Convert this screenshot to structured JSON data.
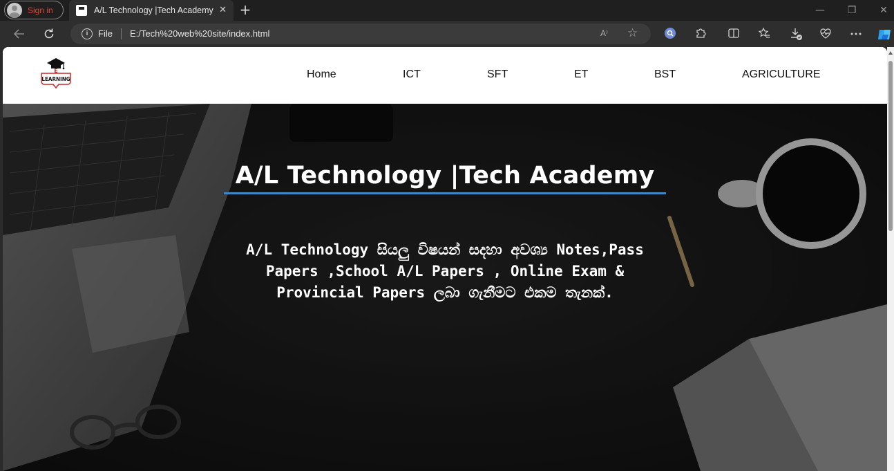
{
  "browser": {
    "profile_label": "Sign in",
    "tab_title": "A/L Technology |Tech Academy",
    "tab_close": "✕",
    "new_tab": "+",
    "address_scheme": "File",
    "address_url": "E:/Tech%20web%20site/index.html",
    "read_aloud": "A⁾",
    "window_controls": [
      "—",
      "❐",
      "✕"
    ]
  },
  "site": {
    "logo_text": "LEARNING",
    "logo_letter": "E",
    "nav": [
      "Home",
      "ICT",
      "SFT",
      "ET",
      "BST",
      "AGRICULTURE"
    ],
    "hero_title": "A/L Technology |Tech Academy",
    "hero_text": "A/L Technology සියලු විෂයන් සදහා අවශ්‍ය Notes,Pass Papers ,School A/L Papers , Online Exam & Provincial Papers ලබා ගැනීමට එකම තැනක්."
  },
  "colors": {
    "accent_rule": "#3d87c9",
    "sign_in_red": "#d9483b"
  },
  "icons": {
    "back": "back-arrow-icon",
    "refresh": "refresh-icon",
    "info": "info-icon",
    "favorite": "star-icon",
    "extensions": "puzzle-icon",
    "split": "split-screen-icon",
    "favorites": "favorites-icon",
    "downloads": "download-icon",
    "health": "heart-pulse-icon",
    "more": "more-icon",
    "copilot": "copilot-icon"
  }
}
